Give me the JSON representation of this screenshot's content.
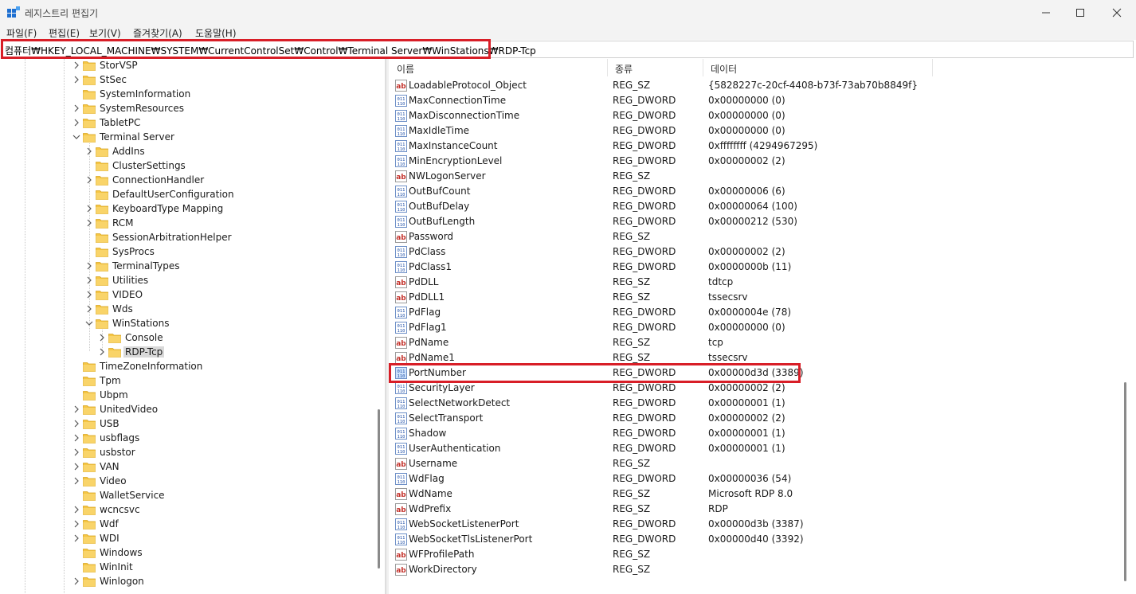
{
  "window": {
    "title": "레지스트리 편집기"
  },
  "menu": [
    "파일(F)",
    "편집(E)",
    "보기(V)",
    "즐겨찾기(A)",
    "도움말(H)"
  ],
  "address": "컴퓨터₩HKEY_LOCAL_MACHINE₩SYSTEM₩CurrentControlSet₩Control₩Terminal Server₩WinStations₩RDP-Tcp",
  "columns": {
    "name": "이름",
    "type": "종류",
    "data": "데이터"
  },
  "tree": [
    {
      "label": "StorVSP",
      "expander": "collapsed",
      "level": 0
    },
    {
      "label": "StSec",
      "expander": "collapsed",
      "level": 0
    },
    {
      "label": "SystemInformation",
      "expander": "none",
      "level": 0
    },
    {
      "label": "SystemResources",
      "expander": "collapsed",
      "level": 0
    },
    {
      "label": "TabletPC",
      "expander": "collapsed",
      "level": 0
    },
    {
      "label": "Terminal Server",
      "expander": "expanded",
      "level": 0
    },
    {
      "label": "AddIns",
      "expander": "collapsed",
      "level": 1
    },
    {
      "label": "ClusterSettings",
      "expander": "none",
      "level": 1
    },
    {
      "label": "ConnectionHandler",
      "expander": "collapsed",
      "level": 1
    },
    {
      "label": "DefaultUserConfiguration",
      "expander": "none",
      "level": 1
    },
    {
      "label": "KeyboardType Mapping",
      "expander": "collapsed",
      "level": 1
    },
    {
      "label": "RCM",
      "expander": "collapsed",
      "level": 1
    },
    {
      "label": "SessionArbitrationHelper",
      "expander": "none",
      "level": 1
    },
    {
      "label": "SysProcs",
      "expander": "none",
      "level": 1
    },
    {
      "label": "TerminalTypes",
      "expander": "collapsed",
      "level": 1
    },
    {
      "label": "Utilities",
      "expander": "collapsed",
      "level": 1
    },
    {
      "label": "VIDEO",
      "expander": "collapsed",
      "level": 1
    },
    {
      "label": "Wds",
      "expander": "collapsed",
      "level": 1
    },
    {
      "label": "WinStations",
      "expander": "expanded",
      "level": 1
    },
    {
      "label": "Console",
      "expander": "collapsed",
      "level": 2
    },
    {
      "label": "RDP-Tcp",
      "expander": "collapsed",
      "level": 2,
      "selected": true
    },
    {
      "label": "TimeZoneInformation",
      "expander": "none",
      "level": 0
    },
    {
      "label": "Tpm",
      "expander": "none",
      "level": 0
    },
    {
      "label": "Ubpm",
      "expander": "none",
      "level": 0
    },
    {
      "label": "UnitedVideo",
      "expander": "collapsed",
      "level": 0
    },
    {
      "label": "USB",
      "expander": "collapsed",
      "level": 0
    },
    {
      "label": "usbflags",
      "expander": "collapsed",
      "level": 0
    },
    {
      "label": "usbstor",
      "expander": "collapsed",
      "level": 0
    },
    {
      "label": "VAN",
      "expander": "collapsed",
      "level": 0
    },
    {
      "label": "Video",
      "expander": "collapsed",
      "level": 0
    },
    {
      "label": "WalletService",
      "expander": "none",
      "level": 0
    },
    {
      "label": "wcncsvc",
      "expander": "collapsed",
      "level": 0
    },
    {
      "label": "Wdf",
      "expander": "collapsed",
      "level": 0
    },
    {
      "label": "WDI",
      "expander": "collapsed",
      "level": 0
    },
    {
      "label": "Windows",
      "expander": "none",
      "level": 0
    },
    {
      "label": "WinInit",
      "expander": "none",
      "level": 0
    },
    {
      "label": "Winlogon",
      "expander": "collapsed",
      "level": 0
    }
  ],
  "values": [
    {
      "name": "LoadableProtocol_Object",
      "type": "REG_SZ",
      "data": "{5828227c-20cf-4408-b73f-73ab70b8849f}",
      "icon": "string"
    },
    {
      "name": "MaxConnectionTime",
      "type": "REG_DWORD",
      "data": "0x00000000 (0)",
      "icon": "binary"
    },
    {
      "name": "MaxDisconnectionTime",
      "type": "REG_DWORD",
      "data": "0x00000000 (0)",
      "icon": "binary"
    },
    {
      "name": "MaxIdleTime",
      "type": "REG_DWORD",
      "data": "0x00000000 (0)",
      "icon": "binary"
    },
    {
      "name": "MaxInstanceCount",
      "type": "REG_DWORD",
      "data": "0xffffffff (4294967295)",
      "icon": "binary"
    },
    {
      "name": "MinEncryptionLevel",
      "type": "REG_DWORD",
      "data": "0x00000002 (2)",
      "icon": "binary"
    },
    {
      "name": "NWLogonServer",
      "type": "REG_SZ",
      "data": "",
      "icon": "string"
    },
    {
      "name": "OutBufCount",
      "type": "REG_DWORD",
      "data": "0x00000006 (6)",
      "icon": "binary"
    },
    {
      "name": "OutBufDelay",
      "type": "REG_DWORD",
      "data": "0x00000064 (100)",
      "icon": "binary"
    },
    {
      "name": "OutBufLength",
      "type": "REG_DWORD",
      "data": "0x00000212 (530)",
      "icon": "binary"
    },
    {
      "name": "Password",
      "type": "REG_SZ",
      "data": "",
      "icon": "string"
    },
    {
      "name": "PdClass",
      "type": "REG_DWORD",
      "data": "0x00000002 (2)",
      "icon": "binary"
    },
    {
      "name": "PdClass1",
      "type": "REG_DWORD",
      "data": "0x0000000b (11)",
      "icon": "binary"
    },
    {
      "name": "PdDLL",
      "type": "REG_SZ",
      "data": "tdtcp",
      "icon": "string"
    },
    {
      "name": "PdDLL1",
      "type": "REG_SZ",
      "data": "tssecsrv",
      "icon": "string"
    },
    {
      "name": "PdFlag",
      "type": "REG_DWORD",
      "data": "0x0000004e (78)",
      "icon": "binary"
    },
    {
      "name": "PdFlag1",
      "type": "REG_DWORD",
      "data": "0x00000000 (0)",
      "icon": "binary"
    },
    {
      "name": "PdName",
      "type": "REG_SZ",
      "data": "tcp",
      "icon": "string"
    },
    {
      "name": "PdName1",
      "type": "REG_SZ",
      "data": "tssecsrv",
      "icon": "string"
    },
    {
      "name": "PortNumber",
      "type": "REG_DWORD",
      "data": "0x00000d3d (3389)",
      "icon": "binary",
      "highlighted": true
    },
    {
      "name": "SecurityLayer",
      "type": "REG_DWORD",
      "data": "0x00000002 (2)",
      "icon": "binary"
    },
    {
      "name": "SelectNetworkDetect",
      "type": "REG_DWORD",
      "data": "0x00000001 (1)",
      "icon": "binary"
    },
    {
      "name": "SelectTransport",
      "type": "REG_DWORD",
      "data": "0x00000002 (2)",
      "icon": "binary"
    },
    {
      "name": "Shadow",
      "type": "REG_DWORD",
      "data": "0x00000001 (1)",
      "icon": "binary"
    },
    {
      "name": "UserAuthentication",
      "type": "REG_DWORD",
      "data": "0x00000001 (1)",
      "icon": "binary"
    },
    {
      "name": "Username",
      "type": "REG_SZ",
      "data": "",
      "icon": "string"
    },
    {
      "name": "WdFlag",
      "type": "REG_DWORD",
      "data": "0x00000036 (54)",
      "icon": "binary"
    },
    {
      "name": "WdName",
      "type": "REG_SZ",
      "data": "Microsoft RDP 8.0",
      "icon": "string"
    },
    {
      "name": "WdPrefix",
      "type": "REG_SZ",
      "data": "RDP",
      "icon": "string"
    },
    {
      "name": "WebSocketListenerPort",
      "type": "REG_DWORD",
      "data": "0x00000d3b (3387)",
      "icon": "binary"
    },
    {
      "name": "WebSocketTlsListenerPort",
      "type": "REG_DWORD",
      "data": "0x00000d40 (3392)",
      "icon": "binary"
    },
    {
      "name": "WFProfilePath",
      "type": "REG_SZ",
      "data": "",
      "icon": "string"
    },
    {
      "name": "WorkDirectory",
      "type": "REG_SZ",
      "data": "",
      "icon": "string"
    }
  ],
  "colors": {
    "highlight": "#d81e27",
    "folder": "#f5c542",
    "selection": "#d9d9d9"
  }
}
